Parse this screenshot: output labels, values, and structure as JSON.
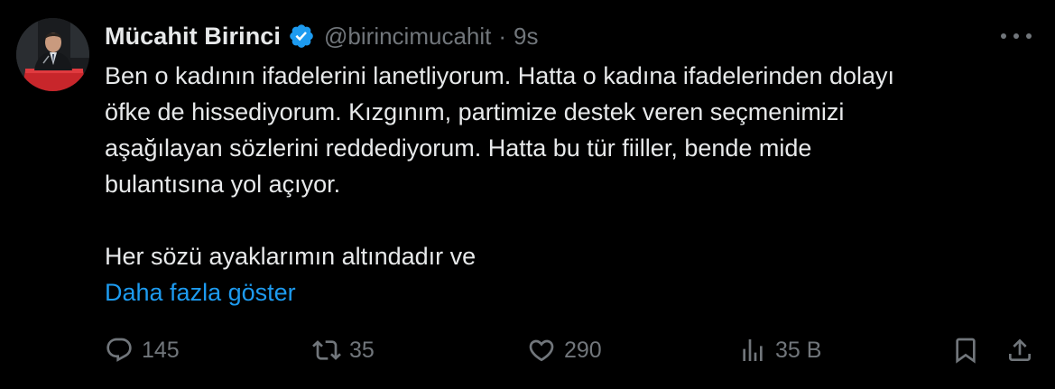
{
  "author": {
    "name": "Mücahit Birinci",
    "handle": "@birincimucahit",
    "separator": "·",
    "time": "9s",
    "verified": true
  },
  "tweet": {
    "lines": [
      "Ben o kadının ifadelerini lanetliyorum. Hatta o kadına ifadelerinden dolayı",
      "öfke de hissediyorum. Kızgınım, partimize destek veren seçmenimizi",
      "aşağılayan sözlerini reddediyorum. Hatta bu tür fiiller, bende mide",
      "bulantısına yol açıyor.",
      "Her sözü ayaklarımın altındadır ve"
    ],
    "show_more": "Daha fazla göster"
  },
  "actions": {
    "reply": {
      "icon": "reply-icon",
      "count": "145"
    },
    "retweet": {
      "icon": "retweet-icon",
      "count": "35"
    },
    "like": {
      "icon": "heart-icon",
      "count": "290"
    },
    "views": {
      "icon": "views-chart-icon",
      "count": "35 B"
    },
    "bookmark": {
      "icon": "bookmark-icon"
    },
    "share": {
      "icon": "share-icon"
    }
  },
  "colors": {
    "background": "#000000",
    "primary_text": "#e7e9ea",
    "secondary_text": "#71767b",
    "link": "#1d9bf0",
    "verified_badge": "#1d9bf0"
  }
}
